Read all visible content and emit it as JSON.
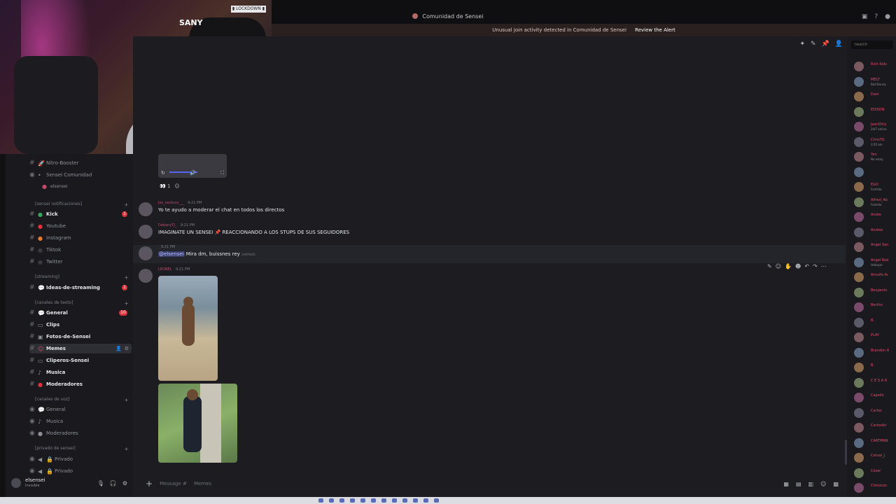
{
  "window": {
    "title": "Comunidad de Sensei"
  },
  "alert": {
    "text": "Unusual join activity detected in Comunidad de Sensei",
    "action": "Review the Alert"
  },
  "webcam": {
    "badge": "▮ LOCKDOWN ▮",
    "overlay_text": "SANY"
  },
  "members_search": {
    "placeholder": "Search"
  },
  "sidebar": {
    "top_rows": [
      {
        "label": "Nitro-Booster",
        "icon": "rocket-icon"
      },
      {
        "label": "Sensei Comunidad",
        "icon": "globe-icon"
      },
      {
        "label": "elsensei",
        "icon": "avatar"
      }
    ],
    "cat_notifications": "[sensei notificaciones]",
    "notif_channels": [
      {
        "label": "Kick",
        "color": "#3ba55d",
        "count": "1",
        "bold": true
      },
      {
        "label": "Youtube",
        "color": "#e0313c"
      },
      {
        "label": "Instagram",
        "color": "#e87a30"
      },
      {
        "label": "Tiktok",
        "color": "#2a2a2e"
      },
      {
        "label": "Twitter",
        "color": "#2a2a2e"
      }
    ],
    "cat_streaming": "[streaming]",
    "streaming_channels": [
      {
        "label": "Ideas-de-streaming",
        "count": "1",
        "bold": true
      }
    ],
    "cat_text": "[canales de texto]",
    "text_channels": [
      {
        "label": "General",
        "count": "10",
        "bold": true
      },
      {
        "label": "Clips",
        "bold": true
      },
      {
        "label": "Fotos-de-Sensei",
        "bold": true
      },
      {
        "label": "Memes",
        "bold": true,
        "active": true
      },
      {
        "label": "Cliperos-Sensei",
        "bold": true
      },
      {
        "label": "Musica",
        "bold": true
      },
      {
        "label": "Moderadores",
        "bold": true
      }
    ],
    "cat_voice": "[canales de voz]",
    "voice_channels": [
      {
        "label": "General"
      },
      {
        "label": "Musica"
      },
      {
        "label": "Moderadores"
      }
    ],
    "cat_private": "[privado de sensei]",
    "private_channels": [
      {
        "label": "Privado"
      },
      {
        "label": "Privado"
      }
    ]
  },
  "user": {
    "name": "elsensei",
    "status": "Invisible"
  },
  "messages": [
    {
      "author": "Jos_ventura___",
      "time": "9:21 PM",
      "text": "Yo te ayudo a moderar el chat en todos los directos"
    },
    {
      "author": "DebanyTJ_",
      "time": "9:21 PM",
      "text": "IMAGINATE UN SENSEI 📌 REACCIONANDO A LOS STUPS DE SUS SEGUIDORES"
    },
    {
      "author": "",
      "time": "9:21 PM",
      "mention": "@elsensei",
      "text": "Mira dm, buissnes rey",
      "edited": "(edited)"
    },
    {
      "author": "LEONEL",
      "time": "9:21 PM",
      "text": ""
    }
  ],
  "reactions": {
    "first": "👀 1",
    "add": "☺"
  },
  "composer": {
    "placeholder": "Message #",
    "channel": "Memes"
  },
  "members": [
    {
      "name": "Rich Kids",
      "sub": ""
    },
    {
      "name": "MELT",
      "sub": "Bad Bunny"
    },
    {
      "name": "Dani",
      "sub": ""
    },
    {
      "name": "EDISON",
      "sub": ""
    },
    {
      "name": "JeanDirly",
      "sub": "24/7 online"
    },
    {
      "name": "ChrisTG",
      "sub": "3:20 am"
    },
    {
      "name": "Yen",
      "sub": "No estoy"
    },
    {
      "name": "",
      "sub": ""
    },
    {
      "name": "EGO",
      "sub": "Fortnite"
    },
    {
      "name": "Alfred_Ab",
      "sub": "Fortnite"
    },
    {
      "name": "Andre",
      "sub": ""
    },
    {
      "name": "Andrés",
      "sub": ""
    },
    {
      "name": "Angel San",
      "sub": ""
    },
    {
      "name": "Angel Rub",
      "sub": "Volkspor"
    },
    {
      "name": "Arnulfo Ar",
      "sub": ""
    },
    {
      "name": "Benjamin",
      "sub": ""
    },
    {
      "name": "Bertho",
      "sub": ""
    },
    {
      "name": "B.",
      "sub": ""
    },
    {
      "name": "PLAY",
      "sub": ""
    },
    {
      "name": "Brandon A",
      "sub": ""
    },
    {
      "name": "B.",
      "sub": ""
    },
    {
      "name": "C E S A R",
      "sub": ""
    },
    {
      "name": "Capello",
      "sub": ""
    },
    {
      "name": "Carlos",
      "sub": ""
    },
    {
      "name": "CarlosAri",
      "sub": ""
    },
    {
      "name": "CARTMAN",
      "sub": ""
    },
    {
      "name": "Catual_J",
      "sub": ""
    },
    {
      "name": "César",
      "sub": ""
    },
    {
      "name": "Chinocon",
      "sub": ""
    },
    {
      "name": "Chino Vil",
      "sub": ""
    }
  ],
  "colors": {
    "accent": "#5865f2",
    "danger": "#e0313c",
    "online": "#3ba55d",
    "member_name": "#e44a6a"
  }
}
